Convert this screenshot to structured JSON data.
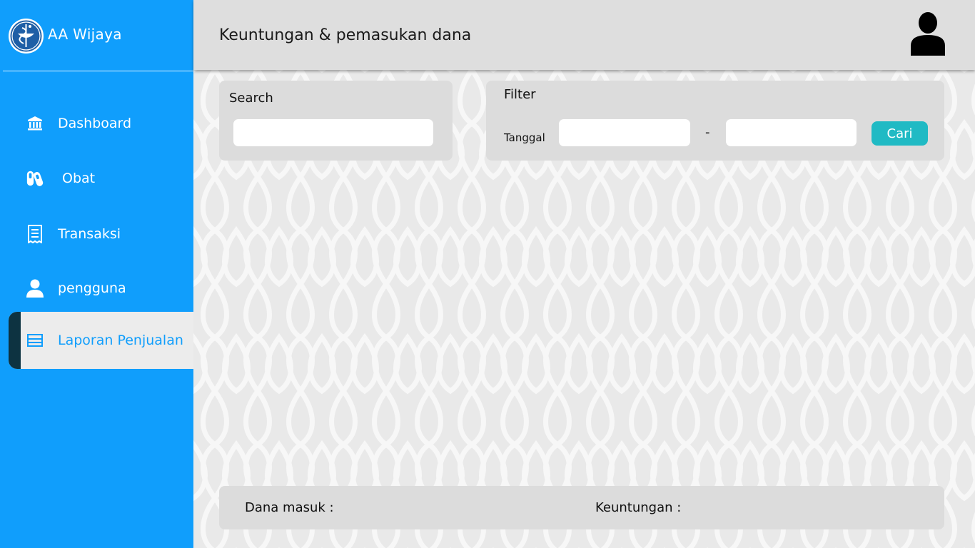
{
  "brand": {
    "name": "AA Wijaya",
    "logo_icon": "pharmacy-caduceus-icon"
  },
  "sidebar": {
    "items": [
      {
        "label": "Dashboard",
        "icon": "bank-icon",
        "active": false
      },
      {
        "label": "Obat",
        "icon": "pills-icon",
        "active": false
      },
      {
        "label": "Transaksi",
        "icon": "receipt-icon",
        "active": false
      },
      {
        "label": "pengguna",
        "icon": "user-icon",
        "active": false
      },
      {
        "label": "Laporan Penjualan",
        "icon": "report-icon",
        "active": true
      }
    ]
  },
  "header": {
    "title": "Keuntungan & pemasukan dana",
    "avatar_icon": "user-avatar-icon"
  },
  "search": {
    "title": "Search",
    "value": ""
  },
  "filter": {
    "title": "Filter",
    "date_label": "Tanggal",
    "date_start": "",
    "separator": "-",
    "date_end": "",
    "button_label": "Cari"
  },
  "summary": {
    "dana_masuk_label": "Dana masuk :",
    "keuntungan_label": "Keuntungan  :"
  },
  "colors": {
    "sidebar": "#109efc",
    "active_bar": "#0d3341",
    "button": "#20bac4",
    "header": "#dedede",
    "panel": "#dcdcdc"
  }
}
